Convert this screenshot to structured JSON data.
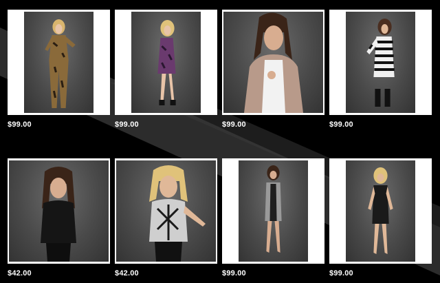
{
  "products": [
    {
      "name": "leopard-print-jumpsuit",
      "price": "$99.00",
      "outfit": "#8a6a3a",
      "accent": "#2a1e12"
    },
    {
      "name": "purple-sequin-dress",
      "price": "$99.00",
      "outfit": "#6a3a6e",
      "accent": "#2a1730"
    },
    {
      "name": "rose-gold-sequin-jacket",
      "price": "$99.00",
      "outfit": "#b89a8a",
      "accent": "#f2f2f2"
    },
    {
      "name": "striped-one-shoulder-dress",
      "price": "$99.00",
      "outfit": "#f0f0f0",
      "accent": "#111111"
    },
    {
      "name": "black-draped-top",
      "price": "$42.00",
      "outfit": "#151515",
      "accent": "#151515"
    },
    {
      "name": "printed-graphic-top",
      "price": "$42.00",
      "outfit": "#cfcfcf",
      "accent": "#1a1a1a"
    },
    {
      "name": "colorblock-bodycon-dress",
      "price": "$99.00",
      "outfit": "#9a9a9a",
      "accent": "#1f1f1f"
    },
    {
      "name": "black-cutout-dress",
      "price": "$99.00",
      "outfit": "#1a1a1a",
      "accent": "#1a1a1a"
    }
  ]
}
